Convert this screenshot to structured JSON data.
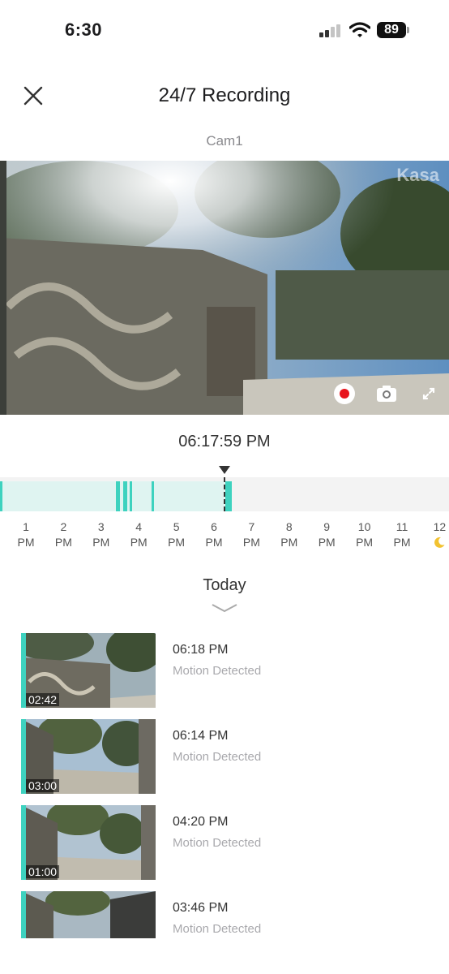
{
  "status_bar": {
    "time": "6:30",
    "battery": "89"
  },
  "header": {
    "title": "24/7 Recording",
    "camera_name": "Cam1"
  },
  "video": {
    "brand": "Kasa"
  },
  "playback": {
    "current_time": "06:17:59 PM"
  },
  "timeline": {
    "hours": [
      {
        "num": "1",
        "ampm": "PM"
      },
      {
        "num": "2",
        "ampm": "PM"
      },
      {
        "num": "3",
        "ampm": "PM"
      },
      {
        "num": "4",
        "ampm": "PM"
      },
      {
        "num": "5",
        "ampm": "PM"
      },
      {
        "num": "6",
        "ampm": "PM"
      },
      {
        "num": "7",
        "ampm": "PM"
      },
      {
        "num": "8",
        "ampm": "PM"
      },
      {
        "num": "9",
        "ampm": "PM"
      },
      {
        "num": "10",
        "ampm": "PM"
      },
      {
        "num": "11",
        "ampm": "PM"
      },
      {
        "num": "12",
        "ampm": ""
      }
    ],
    "accent_color": "#3ed2bf"
  },
  "section": {
    "title": "Today"
  },
  "clips": [
    {
      "duration": "02:42",
      "time": "06:18 PM",
      "label": "Motion Detected"
    },
    {
      "duration": "03:00",
      "time": "06:14 PM",
      "label": "Motion Detected"
    },
    {
      "duration": "01:00",
      "time": "04:20 PM",
      "label": "Motion Detected"
    },
    {
      "duration": "",
      "time": "03:46 PM",
      "label": "Motion Detected"
    }
  ],
  "icons": [
    "close-icon",
    "record-icon",
    "camera-icon",
    "fullscreen-icon",
    "moon-icon",
    "chevron-down-icon"
  ]
}
